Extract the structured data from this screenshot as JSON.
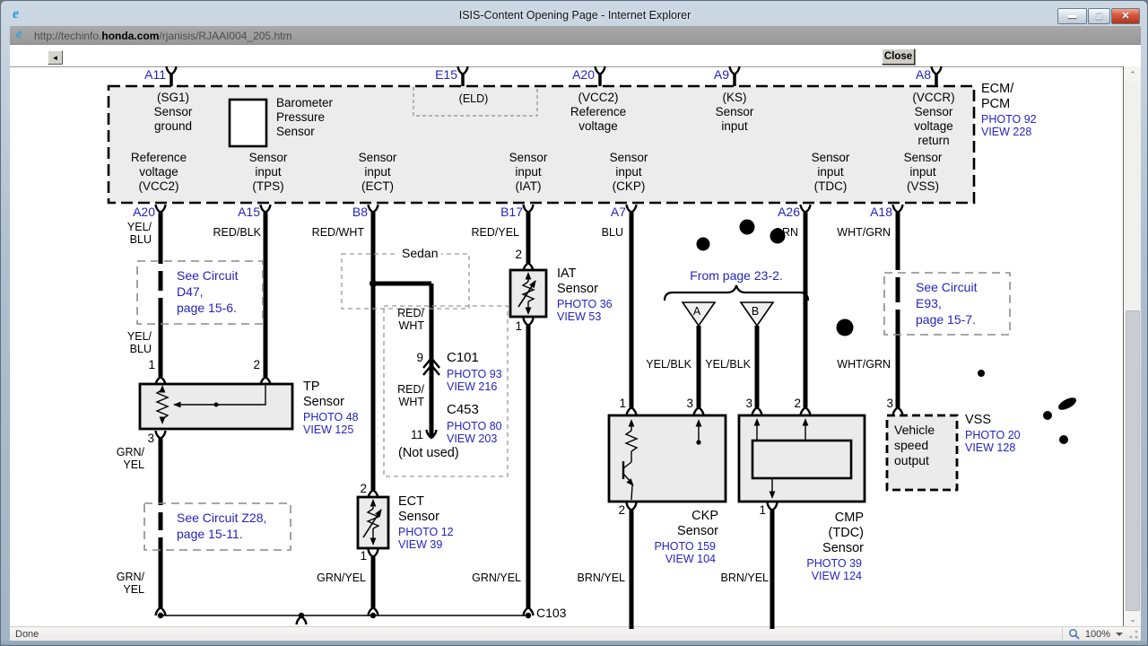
{
  "window": {
    "title": "ISIS-Content Opening Page - Internet Explorer"
  },
  "address": {
    "url_prefix": "http://techinfo.",
    "url_domain": "honda.com",
    "url_path": "/rjanisis/RJAAI004_205.htm"
  },
  "toolbar": {
    "back_glyph": "◄",
    "close_label": "Close"
  },
  "statusbar": {
    "status": "Done",
    "zoom_level": "100%"
  },
  "diagram": {
    "ecm": {
      "pins_top": [
        "A11",
        "E15",
        "A20",
        "A9",
        "A8"
      ],
      "pins_bottom": [
        "A20",
        "A15",
        "B8",
        "B17",
        "A7",
        "A26",
        "A18"
      ],
      "sg1": "(SG1)\nSensor\nground",
      "baro": "Barometer\nPressure\nSensor",
      "eld": "(ELD)",
      "vcc2_top": "(VCC2)\nReference\nvoltage",
      "ks": "(KS)\nSensor\ninput",
      "vccr": "(VCCR)\nSensor\nvoltage\nreturn",
      "name": "ECM/\nPCM",
      "photo": "PHOTO 92\nVIEW 228",
      "bottom_labels": [
        "Reference\nvoltage\n(VCC2)",
        "Sensor\ninput\n(TPS)",
        "Sensor\ninput\n(ECT)",
        "Sensor\ninput\n(IAT)",
        "Sensor\ninput\n(CKP)",
        "Sensor\ninput\n(TDC)",
        "Sensor\ninput\n(VSS)"
      ]
    },
    "wire_labels": {
      "a20_upper": "YEL/\nBLU",
      "a20_lower": "YEL/\nBLU",
      "a15": "RED/BLK",
      "b8": "RED/WHT",
      "sedan_upper": "RED/\nWHT",
      "sedan_lower": "RED/\nWHT",
      "b17": "RED/YEL",
      "a7": "BLU",
      "a26": "GRN",
      "a18_upper": "WHT/GRN",
      "a18_lower": "WHT/GRN",
      "tri_a": "YEL/BLK",
      "tri_b": "YEL/BLK",
      "tp3_upper": "GRN/\nYEL",
      "tp3_lower": "GRN/\nYEL",
      "ect_bottom": "GRN/YEL",
      "iat_bottom": "GRN/YEL",
      "ckp_bottom": "BRN/YEL",
      "cmp_bottom": "BRN/YEL"
    },
    "pin_numbers": {
      "tp1": "1",
      "tp2": "2",
      "tp3": "3",
      "c101": "9",
      "c453": "11",
      "ect2": "2",
      "ect1": "1",
      "iat2": "2",
      "iat1": "1",
      "ckp1": "1",
      "ckp3": "3",
      "ckp2": "2",
      "cmp3": "3",
      "cmp2": "2",
      "cmp1": "1",
      "vss3": "3"
    },
    "refs": {
      "d47": "See Circuit\nD47,\npage 15-6.",
      "z28": "See Circuit Z28,\npage 15-11.",
      "e93": "See Circuit\nE93,\npage 15-7.",
      "from_page": "From page 23-2.",
      "sedan": "Sedan",
      "not_used": "(Not used)",
      "c103": "C103"
    },
    "connectors": {
      "c101": "C101",
      "c101_photo": "PHOTO 93\nVIEW 216",
      "c453": "C453",
      "c453_photo": "PHOTO 80\nVIEW 203"
    },
    "sensors": {
      "tp": {
        "name": "TP\nSensor",
        "photo": "PHOTO 48\nVIEW 125"
      },
      "iat": {
        "name": "IAT\nSensor",
        "photo": "PHOTO 36\nVIEW 53"
      },
      "ect": {
        "name": "ECT\nSensor",
        "photo": "PHOTO 12\nVIEW 39"
      },
      "ckp": {
        "name": "CKP\nSensor",
        "photo": "PHOTO 159\nVIEW 104"
      },
      "cmp": {
        "name": "CMP\n(TDC)\nSensor",
        "photo": "PHOTO 39\nVIEW 124"
      },
      "vss": {
        "name": "VSS",
        "photo": "PHOTO 20\nVIEW 128",
        "box": "Vehicle\nspeed\noutput"
      }
    },
    "triangles": {
      "a": "A",
      "b": "B"
    }
  }
}
